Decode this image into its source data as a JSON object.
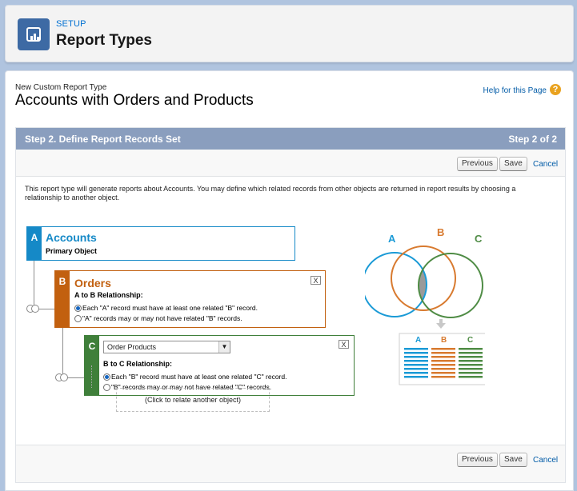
{
  "header": {
    "section": "SETUP",
    "title": "Report Types"
  },
  "page": {
    "breadcrumb": "New Custom Report Type",
    "report_name": "Accounts with Orders and Products",
    "help_link": "Help for this Page",
    "help_icon": "?"
  },
  "step": {
    "title": "Step 2. Define Report Records Set",
    "counter": "Step 2 of 2",
    "previous_label": "Previous",
    "save_label": "Save",
    "cancel_label": "Cancel",
    "description": "This report type will generate reports about Accounts. You may define which related records from other objects are returned in report results by choosing a relationship to another object."
  },
  "objects": {
    "a": {
      "letter": "A",
      "name": "Accounts",
      "subtitle": "Primary Object",
      "color": "#1589c7"
    },
    "b": {
      "letter": "B",
      "name": "Orders",
      "relationship_label": "A to B Relationship:",
      "option_1": "Each \"A\" record must have at least one related \"B\" record.",
      "option_2": "\"A\" records may or may not have related \"B\" records.",
      "selected": 1,
      "close": "X",
      "color": "#c2600f"
    },
    "c": {
      "letter": "C",
      "selected_object": "Order Products",
      "relationship_label": "B to C Relationship:",
      "option_1": "Each \"B\" record must have at least one related \"C\" record.",
      "option_2": "\"B\" records may or may not have related \"C\" records.",
      "selected": 1,
      "close": "X",
      "color": "#3f7f3a"
    },
    "relate_more": "(Click to relate another object)"
  },
  "diagram": {
    "label_a": "A",
    "label_b": "B",
    "label_c": "C",
    "color_a": "#1a9ad6",
    "color_b": "#d87a2f",
    "color_c": "#4f8c45"
  }
}
